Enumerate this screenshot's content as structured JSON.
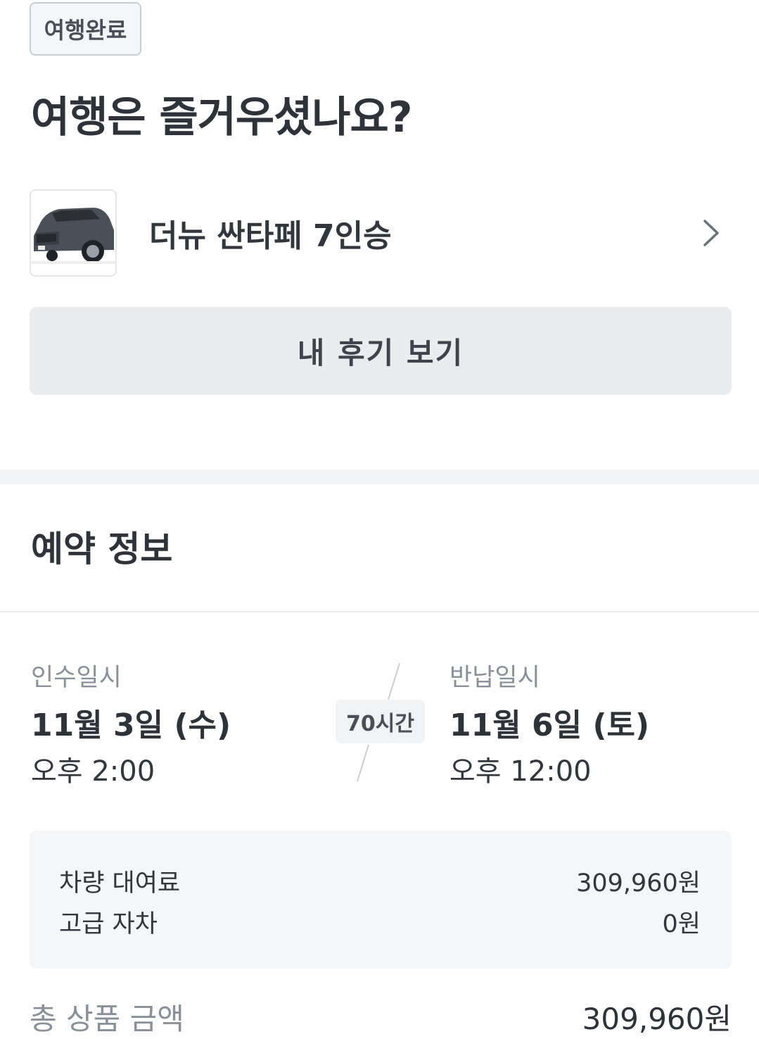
{
  "status_badge": "여행완료",
  "headline": "여행은 즐거우셨나요?",
  "car": {
    "name": "더뉴 싼타페 7인승"
  },
  "review_button_label": "내 후기 보기",
  "reservation": {
    "section_title": "예약 정보",
    "pickup": {
      "label": "인수일시",
      "date": "11월 3일 (수)",
      "time": "오후 2:00"
    },
    "duration": "70시간",
    "return": {
      "label": "반납일시",
      "date": "11월 6일 (토)",
      "time": "오후 12:00"
    },
    "fees": [
      {
        "label": "차량 대여료",
        "amount": "309,960원"
      },
      {
        "label": "고급 자차",
        "amount": "0원"
      }
    ],
    "total": {
      "label": "총 상품 금액",
      "amount": "309,960원"
    }
  }
}
